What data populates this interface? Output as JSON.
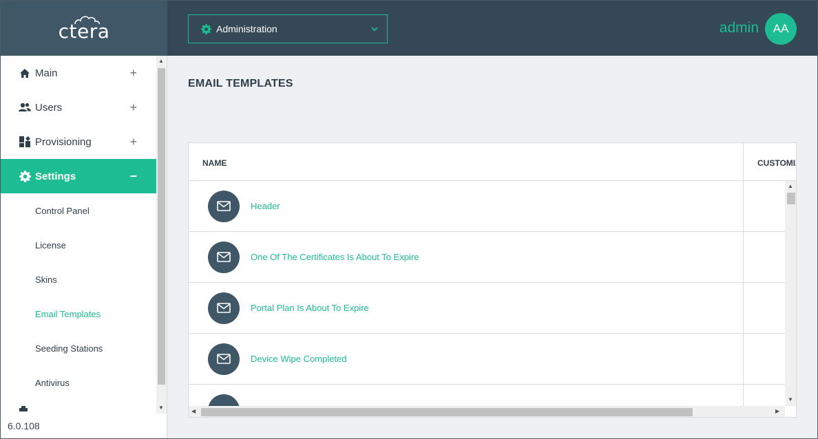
{
  "brand": {
    "logo_text": "ctera"
  },
  "nav": {
    "items": [
      {
        "label": "Main",
        "icon": "home-icon",
        "toggle": "+"
      },
      {
        "label": "Users",
        "icon": "users-icon",
        "toggle": "+"
      },
      {
        "label": "Provisioning",
        "icon": "provisioning-icon",
        "toggle": "+"
      },
      {
        "label": "Settings",
        "icon": "gear-icon",
        "toggle": "−",
        "active": true
      }
    ],
    "sub_items": [
      {
        "label": "Control Panel"
      },
      {
        "label": "License"
      },
      {
        "label": "Skins"
      },
      {
        "label": "Email Templates",
        "active": true
      },
      {
        "label": "Seeding Stations"
      },
      {
        "label": "Antivirus"
      }
    ]
  },
  "version": "6.0.108",
  "header": {
    "context_select": "Administration",
    "user_name": "admin",
    "avatar_initials": "AA"
  },
  "page": {
    "title": "EMAIL TEMPLATES",
    "columns": {
      "name": "NAME",
      "customized": "CUSTOMIZ"
    },
    "rows": [
      {
        "name": "Header"
      },
      {
        "name": "One Of The Certificates Is About To Expire"
      },
      {
        "name": "Portal Plan Is About To Expire"
      },
      {
        "name": "Device Wipe Completed"
      },
      {
        "name": ""
      }
    ]
  },
  "colors": {
    "accent": "#1ebc93",
    "header_bg": "#344955",
    "logo_bg": "#3f5766",
    "main_bg": "#eef0f3"
  }
}
